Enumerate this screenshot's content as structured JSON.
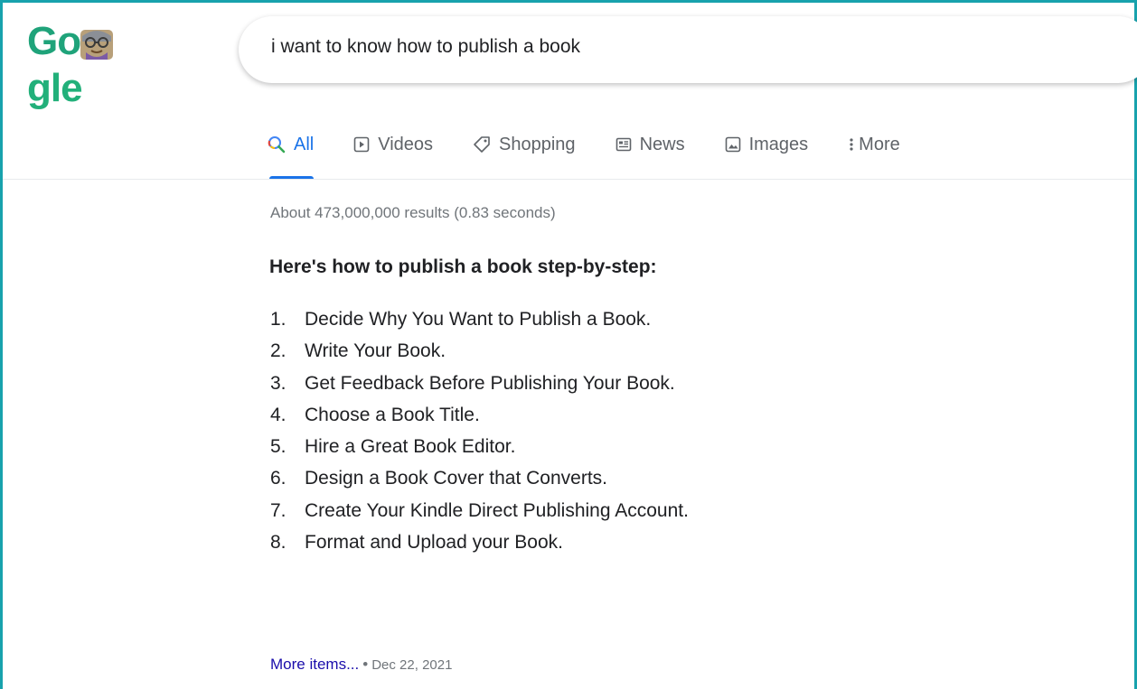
{
  "logo": {
    "prefix": "Go",
    "suffix": "gle",
    "doodle_icon": "doodle-face-icon",
    "colors": {
      "text": "#22b07a"
    }
  },
  "search": {
    "query": "i want to know how to publish a book"
  },
  "tabs": [
    {
      "label": "All",
      "icon": "search-icon",
      "active": true
    },
    {
      "label": "Videos",
      "icon": "play-icon",
      "active": false
    },
    {
      "label": "Shopping",
      "icon": "tag-icon",
      "active": false
    },
    {
      "label": "News",
      "icon": "news-icon",
      "active": false
    },
    {
      "label": "Images",
      "icon": "image-icon",
      "active": false
    },
    {
      "label": "More",
      "icon": "more-vert-icon",
      "active": false
    }
  ],
  "results": {
    "stats": "About 473,000,000 results (0.83 seconds)",
    "snippet_title": "Here's how to publish a book step-by-step:",
    "steps": [
      {
        "num": "1.",
        "text": "Decide Why You Want to Publish a Book."
      },
      {
        "num": "2.",
        "text": "Write Your Book."
      },
      {
        "num": "3.",
        "text": "Get Feedback Before Publishing Your Book."
      },
      {
        "num": "4.",
        "text": "Choose a Book Title."
      },
      {
        "num": "5.",
        "text": "Hire a Great Book Editor."
      },
      {
        "num": "6.",
        "text": "Design a Book Cover that Converts."
      },
      {
        "num": "7.",
        "text": "Create Your Kindle Direct Publishing Account."
      },
      {
        "num": "8.",
        "text": "Format and Upload your Book."
      }
    ],
    "more_items": "More items...",
    "separator": "•",
    "date": "Dec 22, 2021"
  },
  "colors": {
    "accent": "#1a73e8",
    "link": "#1a0dab",
    "frame": "#18a2ad"
  }
}
